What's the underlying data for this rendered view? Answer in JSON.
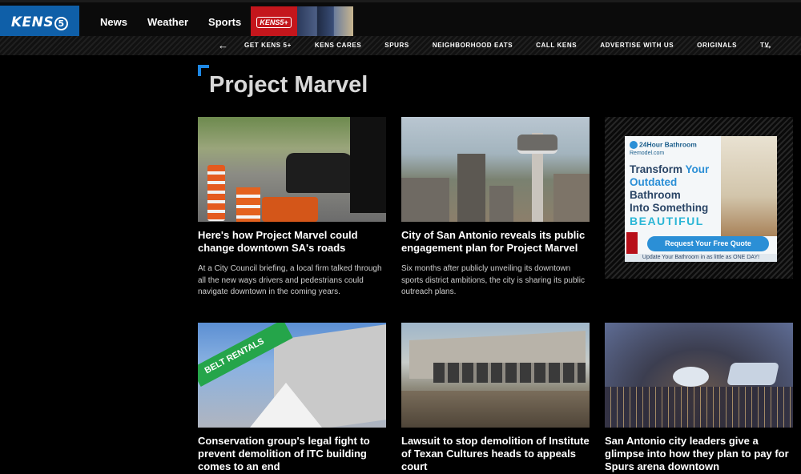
{
  "header": {
    "logo_text": "KENS",
    "logo_number": "5",
    "nav": [
      "News",
      "Weather",
      "Sports"
    ],
    "promo_label": "KENS5+"
  },
  "subnav": {
    "prev_icon": "arrow-left-icon",
    "next_icon": "arrow-right-icon",
    "items": [
      "GET KENS 5+",
      "KENS CARES",
      "SPURS",
      "NEIGHBORHOOD EATS",
      "CALL KENS",
      "ADVERTISE WITH US",
      "ORIGINALS",
      "TV"
    ]
  },
  "page": {
    "title": "Project Marvel"
  },
  "articles": [
    {
      "headline": "Here's how Project Marvel could change downtown SA's roads",
      "summary": "At a City Council briefing, a local firm talked through all the new ways drivers and pedestrians could navigate downtown in the coming years."
    },
    {
      "headline": "City of San Antonio reveals its public engagement plan for Project Marvel",
      "summary": "Six months after publicly unveiling its downtown sports district ambitions, the city is sharing its public outreach plans."
    },
    {
      "headline": "Conservation group's legal fight to prevent demolition of ITC building comes to an end",
      "summary": ""
    },
    {
      "headline": "Lawsuit to stop demolition of Institute of Texan Cultures heads to appeals court",
      "summary": ""
    },
    {
      "headline": "San Antonio city leaders give a glimpse into how they plan to pay for Spurs arena downtown",
      "summary": ""
    }
  ],
  "images": {
    "crane_text": "BELT RENTALS"
  },
  "ad": {
    "brand_line1": "24Hour Bathroom",
    "brand_line2": "Remodel.com",
    "headline_1": "Transform",
    "headline_2": "Your",
    "headline_3": "Outdated",
    "headline_4": "Bathroom",
    "headline_5": "Into Something",
    "headline_6": "BEAUTIFUL",
    "cta": "Request Your Free Quote",
    "footer": "Update Your Bathroom in as little as ONE DAY!"
  },
  "colors": {
    "accent": "#1e88e5",
    "logo_bg": "#0f5fa8",
    "promo_bg": "#c4161c"
  }
}
